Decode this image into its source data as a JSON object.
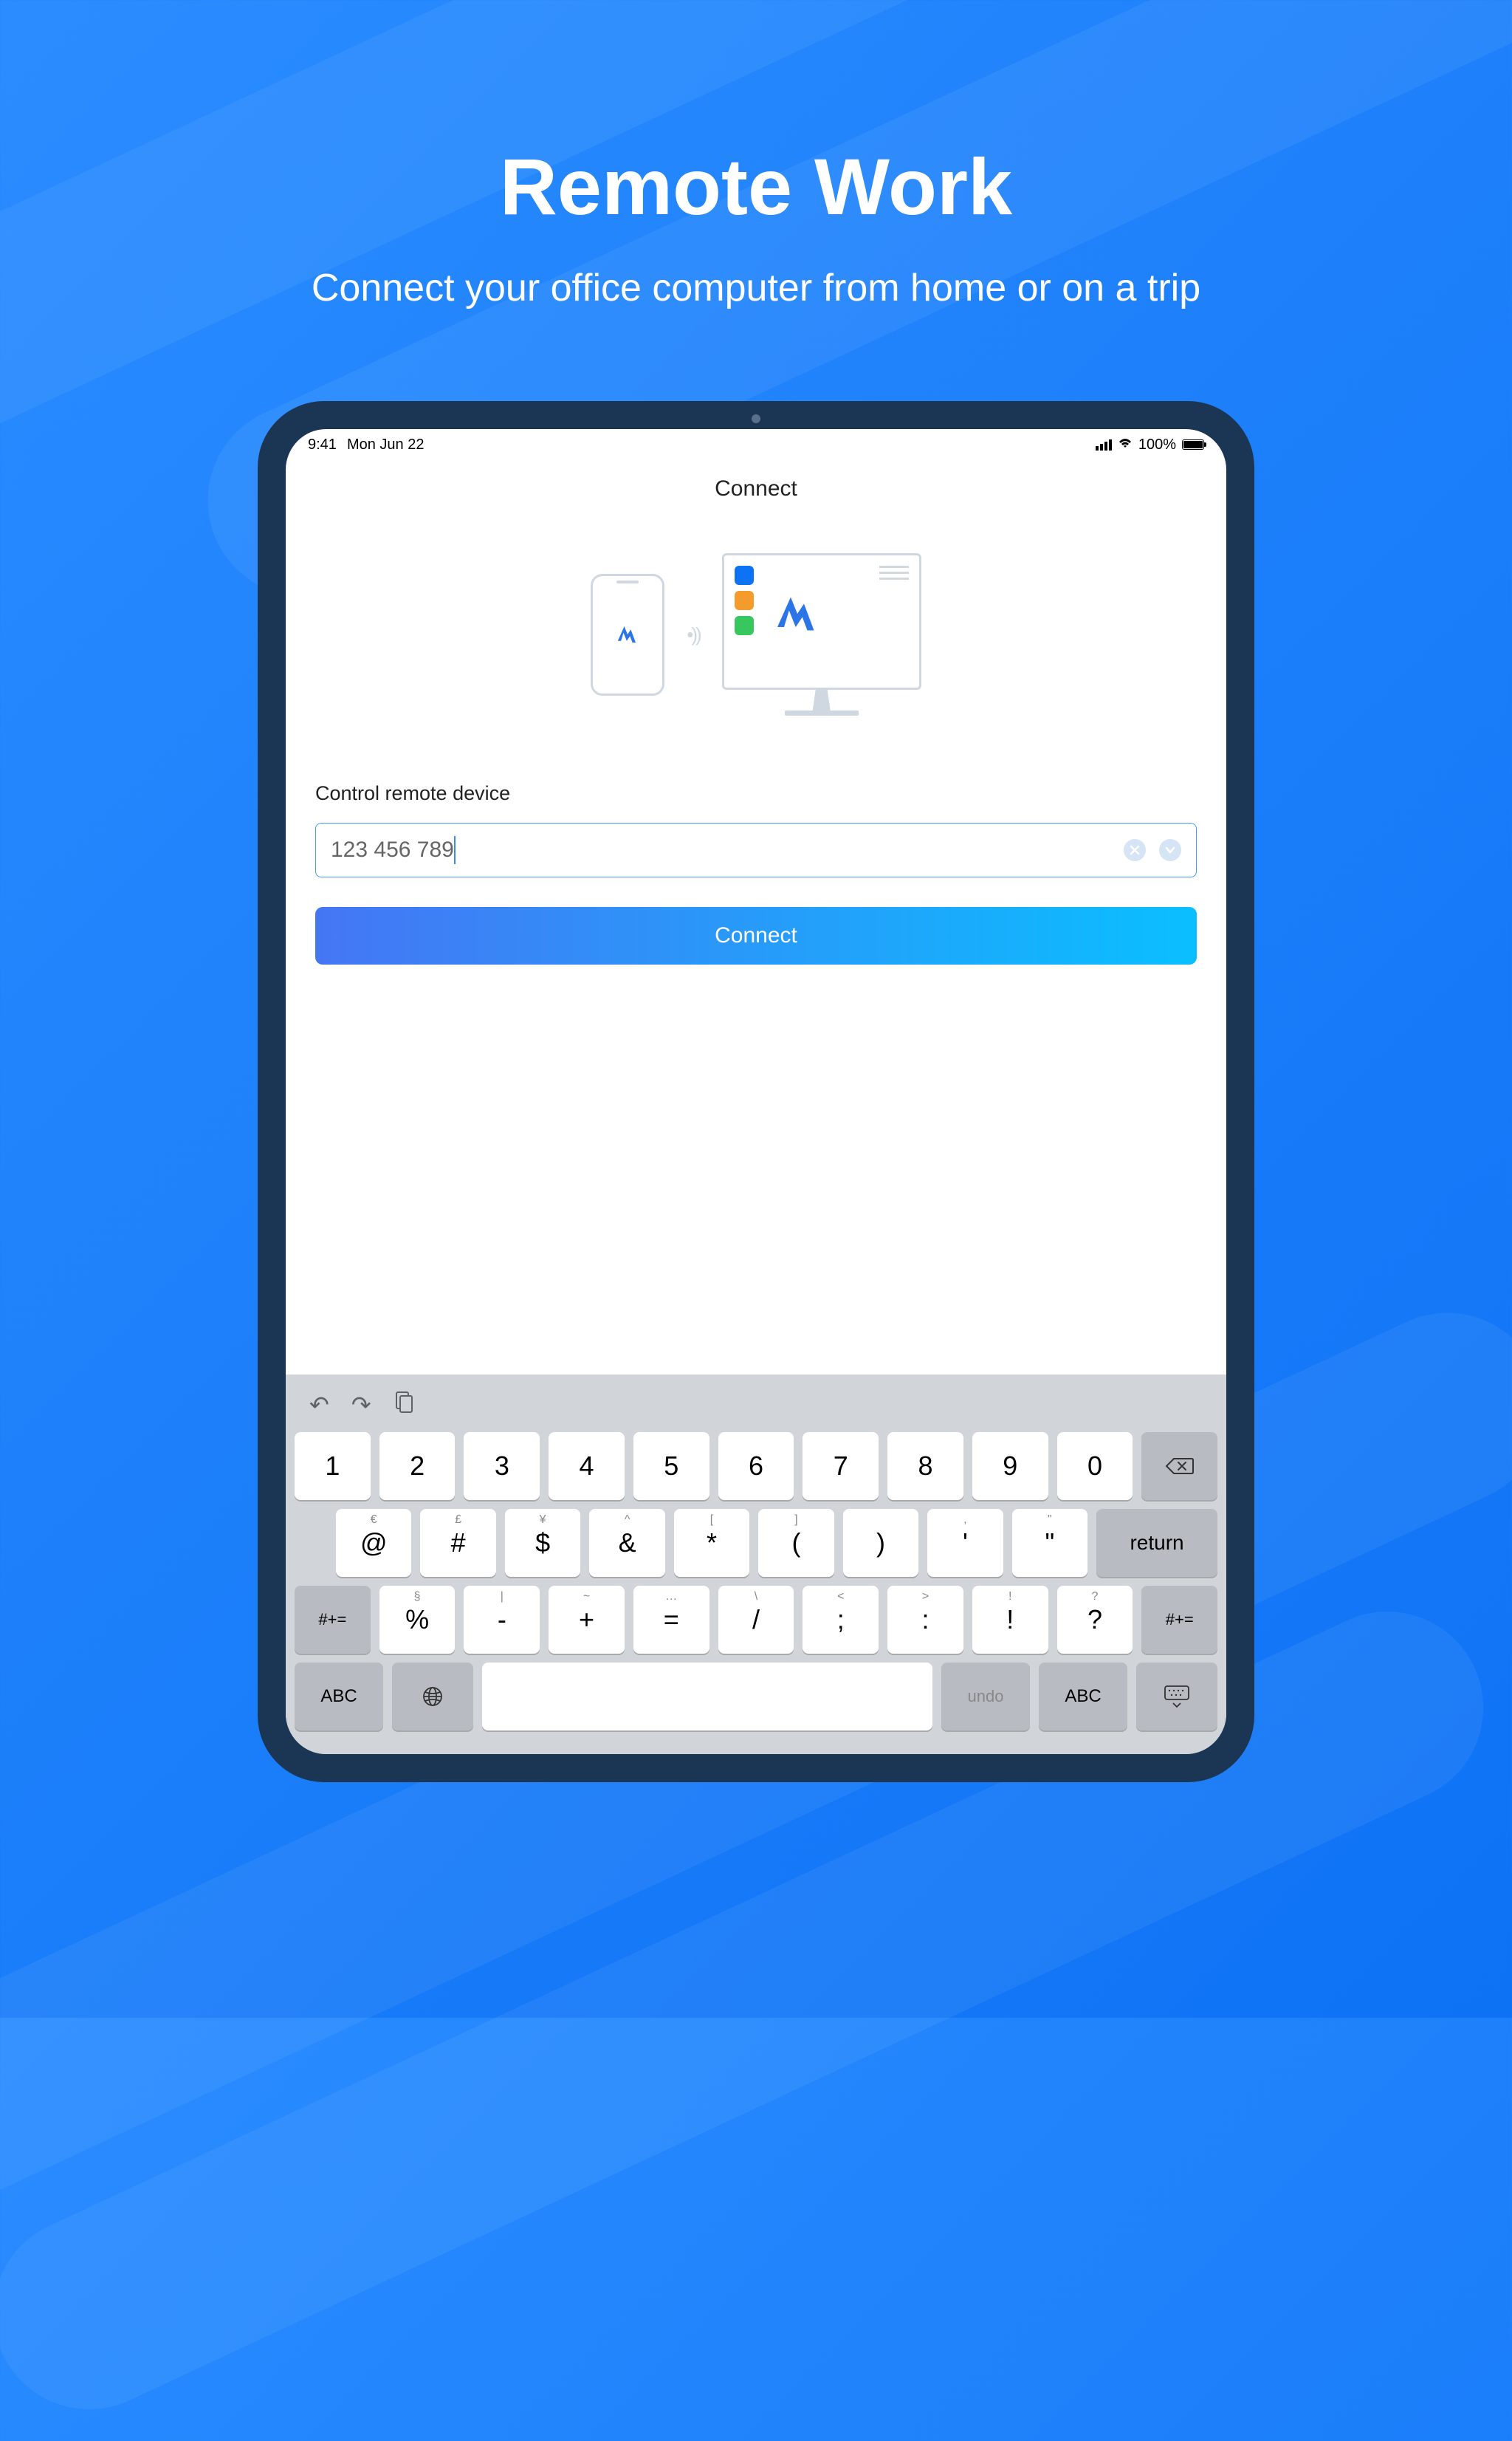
{
  "hero": {
    "title": "Remote Work",
    "subtitle": "Connect your office computer from home or on a trip"
  },
  "status": {
    "time": "9:41",
    "date": "Mon Jun 22",
    "battery_pct": "100%"
  },
  "app": {
    "header": "Connect",
    "form_label": "Control remote device",
    "input_value": "123 456 789",
    "connect_button": "Connect"
  },
  "keyboard": {
    "row1": [
      {
        "main": "1",
        "alt": ""
      },
      {
        "main": "2",
        "alt": ""
      },
      {
        "main": "3",
        "alt": ""
      },
      {
        "main": "4",
        "alt": ""
      },
      {
        "main": "5",
        "alt": ""
      },
      {
        "main": "6",
        "alt": ""
      },
      {
        "main": "7",
        "alt": ""
      },
      {
        "main": "8",
        "alt": ""
      },
      {
        "main": "9",
        "alt": ""
      },
      {
        "main": "0",
        "alt": ""
      }
    ],
    "row2": [
      {
        "main": "@",
        "alt": "€"
      },
      {
        "main": "#",
        "alt": "£"
      },
      {
        "main": "$",
        "alt": "¥"
      },
      {
        "main": "&",
        "alt": "^"
      },
      {
        "main": "*",
        "alt": "["
      },
      {
        "main": "(",
        "alt": "]"
      },
      {
        "main": ")",
        "alt": ""
      },
      {
        "main": "'",
        "alt": ","
      },
      {
        "main": "\"",
        "alt": "\""
      }
    ],
    "row3_left": "#+=",
    "row3": [
      {
        "main": "%",
        "alt": "§"
      },
      {
        "main": "-",
        "alt": "|"
      },
      {
        "main": "+",
        "alt": "~"
      },
      {
        "main": "=",
        "alt": "…"
      },
      {
        "main": "/",
        "alt": "\\"
      },
      {
        "main": ";",
        "alt": "<"
      },
      {
        "main": ":",
        "alt": ">"
      },
      {
        "main": "!",
        "alt": "!"
      },
      {
        "main": "?",
        "alt": "?"
      }
    ],
    "row3_right": "#+=",
    "return": "return",
    "abc": "ABC",
    "undo": "undo"
  }
}
